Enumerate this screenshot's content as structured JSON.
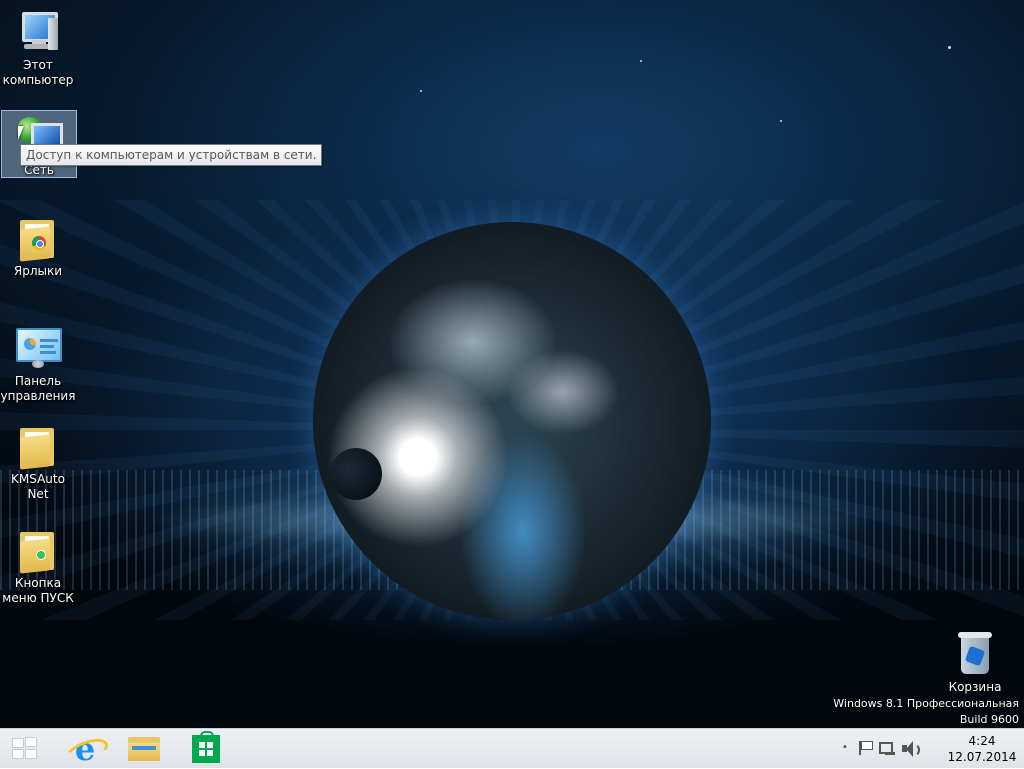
{
  "desktop": {
    "icons": [
      {
        "label": "Этот компьютер"
      },
      {
        "label": "Сеть"
      },
      {
        "label": "Ярлыки"
      },
      {
        "label": "Панель управления"
      },
      {
        "label": "KMSAuto Net"
      },
      {
        "label": "Кнопка меню ПУСК"
      }
    ],
    "recycle_bin": {
      "label": "Корзина"
    },
    "tooltip": "Доступ к компьютерам и устройствам в сети.",
    "watermark": {
      "edition": "Windows 8.1 Профессиональная",
      "build": "Build 9600"
    }
  },
  "taskbar": {
    "pinned": [
      {
        "icon": "start-icon"
      },
      {
        "icon": "internet-explorer-icon"
      },
      {
        "icon": "file-explorer-icon"
      },
      {
        "icon": "store-icon"
      }
    ],
    "tray": {
      "overflow_dot": "•",
      "icons": [
        "action-center-flag-icon",
        "network-icon",
        "volume-icon"
      ]
    },
    "clock": {
      "time": "4:24",
      "date": "12.07.2014"
    }
  }
}
